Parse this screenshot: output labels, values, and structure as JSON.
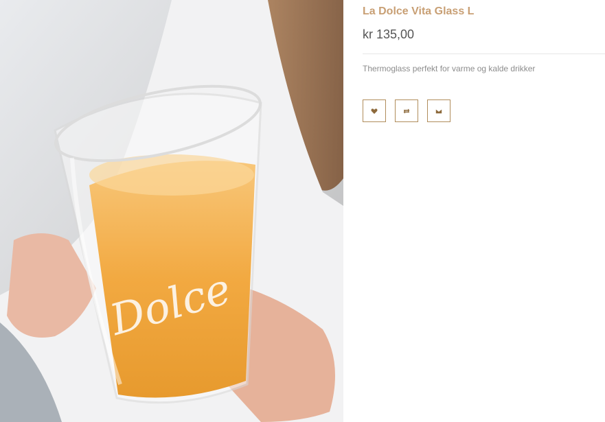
{
  "product": {
    "title": "La Dolce Vita Glass L",
    "price": "kr 135,00",
    "description": "Thermoglass perfekt for varme og kalde drikker",
    "image_text": "Dolce"
  },
  "actions": [
    {
      "icon": "heart-icon"
    },
    {
      "icon": "compare-icon"
    },
    {
      "icon": "envelope-icon"
    }
  ],
  "colors": {
    "title": "#c89f74",
    "button_border": "#b08c5a"
  }
}
